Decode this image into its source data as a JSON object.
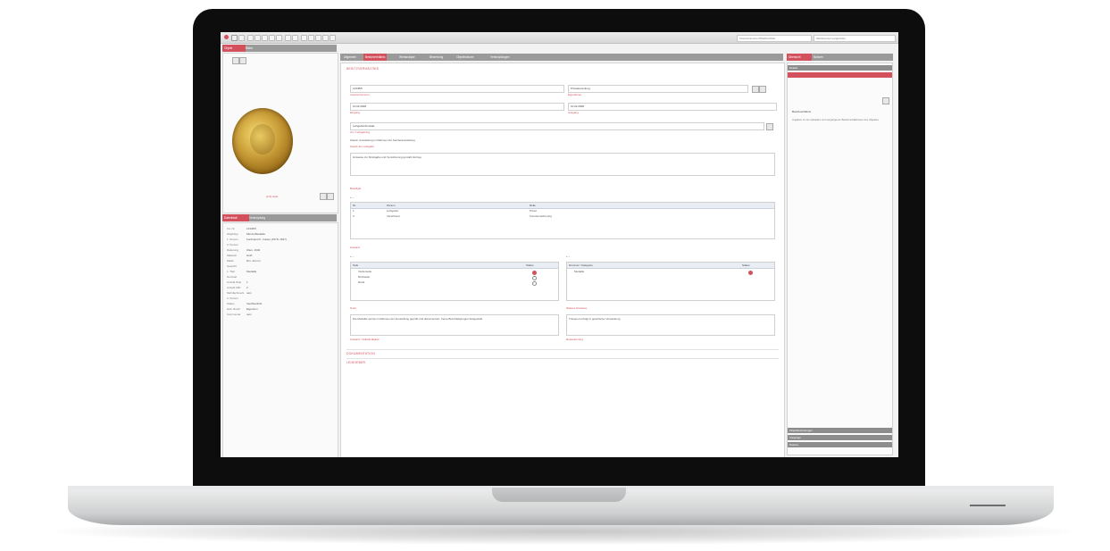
{
  "colors": {
    "accent": "#d3505d",
    "bezel": "#0d0d0d",
    "tab_bar": "#9a9a9a"
  },
  "toolbar": {
    "search_placeholder": "Inventarnummer/Titel/Kurztitel",
    "search_field_2": "Wertkonzept vergleichen"
  },
  "left": {
    "tabs": [
      "Objekt",
      "Bilder"
    ],
    "image_caption": "(1/1) seite",
    "meta_tabs": [
      "Datenblatt",
      "Verknüpfung"
    ],
    "meta": [
      {
        "k": "Inv. Nr.",
        "v": "12345/5"
      },
      {
        "k": "Objekttyp",
        "v": "Münze/Medaille"
      },
      {
        "k": "1. Person",
        "v": "Ferdinand II., Kaiser (1578–1637)"
      },
      {
        "k": "2. Person",
        "v": ""
      },
      {
        "k": "Datierung",
        "v": "Wien, 1640"
      },
      {
        "k": "Material",
        "v": "Gold"
      },
      {
        "k": "Maße",
        "v": "Dm. 44 mm"
      },
      {
        "k": "Gewicht",
        "v": ""
      },
      {
        "k": "1. Titel",
        "v": "Medaille"
      },
      {
        "k": "Nominal",
        "v": ""
      },
      {
        "k": "Anzahl Teile",
        "v": "1"
      },
      {
        "k": "Anzahl Abb.",
        "v": "2"
      },
      {
        "k": "Mehrfachmerk.",
        "v": "nein"
      },
      {
        "k": "2. Person",
        "v": ""
      },
      {
        "k": "Status",
        "v": "Veröffentlicht"
      },
      {
        "k": "Hab. Recht",
        "v": "Eigentum"
      },
      {
        "k": "Kommentar",
        "v": "nein"
      }
    ]
  },
  "main": {
    "tabs": [
      "Allgemein",
      "Besitzverhältnis",
      "Wertanalyse",
      "Bewertung",
      "Objekthistorie",
      "Verknüpfungen"
    ],
    "active_tab": 1,
    "section1_title": "BESITZVERHÄLTNIS",
    "field_num": "12345/5",
    "field_num_label": "Inventarnummer",
    "field_owner": "Privatsammlung",
    "field_owner_label": "Eigentümer",
    "date_from": "10.02.2008",
    "date_from_label": "Eingang",
    "date_to": "10.02.2008",
    "date_to_label": "Ausgang",
    "contact": "Leihgeber/Kontakt",
    "contact_label": "Art / Leihgebung",
    "note_line": "Zweck: Ausstellung im Rahmen der Sonderausstellung",
    "note_label": "Zweck der Leihgabe",
    "description": "Hinweise zur Rückgabe und Versicherung gemäß Vertrag.",
    "section_parties": "Beteiligte",
    "table_headers": [
      "Nr.",
      "Person",
      "Rolle"
    ],
    "table_rows": [
      [
        "1",
        "Leihgeber",
        "Privat"
      ],
      [
        "2",
        "Versicherer",
        "Kunstversicherung"
      ]
    ],
    "section_status": "Zustand",
    "left_list_headers": [
      "Teile",
      "Status"
    ],
    "left_list": [
      "Vorderseite",
      "Rückseite",
      "Rand"
    ],
    "right_list_headers": [
      "Nummer / Kategorie",
      "Status"
    ],
    "right_list": [
      "Medaille"
    ],
    "text_label_1": "Notiz",
    "text_block_1": "Die Medaille wurde im Rahmen der Ausstellung geprüft und dokumentiert. Keine Beschädigungen festgestellt.",
    "text_label_2": "Weitere Hinweise",
    "text_block_2": "Transport erfolgt in gesicherter Verpackung.",
    "footer_label_1": "Zustand / Vollständigkeit",
    "footer_label_2": "Restaurierung",
    "collapsed": [
      "DOKUMENTATION",
      "LEIHGEBER"
    ]
  },
  "right": {
    "tabs": [
      "Übersicht",
      "Notizen"
    ],
    "header": "Details",
    "heading": "Besitzverhältnis",
    "body": "Angaben zu den aktuellen und vergangenen Besitzverhältnissen des Objektes.",
    "footer_bars": [
      "Objektbeziehungen",
      "Vorgänge",
      "Dateien"
    ]
  }
}
